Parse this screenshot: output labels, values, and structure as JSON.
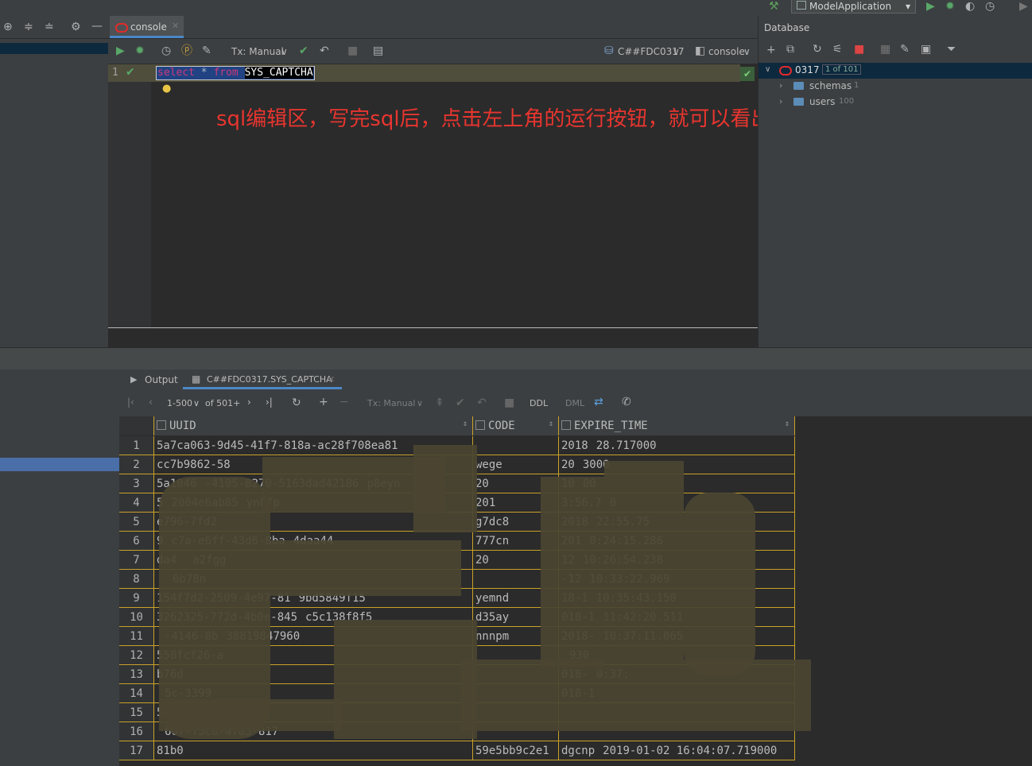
{
  "run_config": {
    "label": "ModelApplication"
  },
  "editor_tab": {
    "label": "console"
  },
  "editor_toolbar": {
    "tx_mode": "Tx: Manual",
    "datasource": "C##FDC0317",
    "session": "console"
  },
  "editor": {
    "line_number": "1",
    "sql_keyword_select": "select",
    "sql_star": "*",
    "sql_keyword_from": "from",
    "sql_table": "SYS_CAPTCHA"
  },
  "annotation": "sql编辑区，写完sql后，点击左上角的运行按钮，就可以看出查询结果",
  "database_panel": {
    "title": "Database",
    "root": {
      "label": "0317",
      "badge": "1 of 101"
    },
    "children": [
      {
        "label": "schemas",
        "count": "1"
      },
      {
        "label": "users",
        "count": "100"
      }
    ]
  },
  "bottom_tabs": {
    "output": "Output",
    "result": "C##FDC0317.SYS_CAPTCHA"
  },
  "result_toolbar": {
    "range": "1-500",
    "of_total": "of 501+",
    "tx_mode": "Tx: Manual",
    "ddl": "DDL",
    "dml": "DML"
  },
  "grid": {
    "columns": [
      "UUID",
      "CODE",
      "EXPIRE_TIME"
    ],
    "rows": [
      [
        "1",
        "5a7ca063-9d45-41f7-818a-ac28f708ea81",
        "",
        "2018",
        "28.717000"
      ],
      [
        "2",
        "cc7b9862-58",
        "wege",
        "20",
        "3000"
      ],
      [
        "3",
        "5a1046",
        "-4105-8270-5163dad42186",
        "p8eyn",
        "20",
        "10",
        "00"
      ],
      [
        "4",
        "5",
        "2004e6ab85",
        "yn8fp",
        "201",
        "3:56.7",
        "0"
      ],
      [
        "5",
        "e796-7fd2",
        "",
        "g7dc8",
        "2018",
        "22:55.75"
      ],
      [
        "6",
        "9",
        "c7a-e6ff-43d6-8ba",
        "4daa44",
        "777cn",
        "201",
        "0:24:15.286"
      ],
      [
        "7",
        "da4",
        "",
        "a2fgg",
        "20",
        "12",
        "10:26:54.238"
      ],
      [
        "8",
        "",
        "",
        "6b78n",
        "",
        "-12",
        "10:33:22.969"
      ],
      [
        "9",
        "154f7d2-2509-4e97-81",
        "9bd5849f15",
        "yemnd",
        "18-1",
        "10:35:43.150"
      ],
      [
        "10",
        "3262325-772d-4b0e-845",
        "c5c138f8f5",
        "d35ay",
        "018-1",
        "11:42:20.511"
      ],
      [
        "11",
        "",
        "-4146-8b",
        "38819847960",
        "nnnpm",
        "2018-",
        "10:37:11.065"
      ],
      [
        "12",
        "558fcf26-a",
        "",
        "",
        "",
        "930"
      ],
      [
        "13",
        "b76d",
        "",
        "",
        "018-",
        "0:37:"
      ],
      [
        "14",
        "",
        "5c-3399",
        "",
        "018-1",
        ""
      ],
      [
        "15",
        "5ac53c-d237-4",
        "",
        "",
        "",
        ""
      ],
      [
        "16",
        "",
        "607-f3c8-4783-817",
        "",
        "",
        ""
      ],
      [
        "17",
        "81b0",
        "59e5bb9c2e1",
        "dgcnp",
        "2019-01-02 16:04:07.719000"
      ]
    ]
  },
  "colors": {
    "panel_bg": "#3c3f41",
    "editor_bg": "#2b2b2b",
    "grid_line": "#c9a227",
    "selection": "#0d293e",
    "annotation": "#e8352f",
    "accent_tab": "#4a88c7"
  }
}
